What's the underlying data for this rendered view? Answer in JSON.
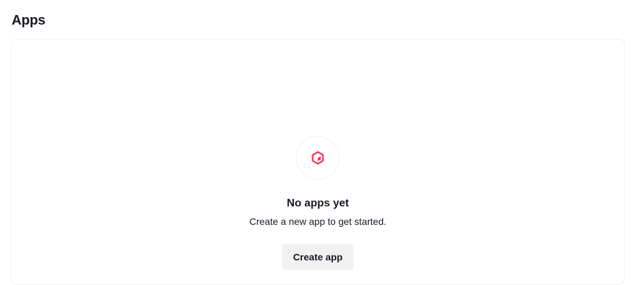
{
  "page": {
    "title": "Apps"
  },
  "empty_state": {
    "icon": "cube-icon",
    "title": "No apps yet",
    "description": "Create a new app to get started.",
    "button_label": "Create app"
  },
  "colors": {
    "accent": "#fe2c55",
    "button_bg": "#f1f1f2",
    "text": "#161823"
  }
}
